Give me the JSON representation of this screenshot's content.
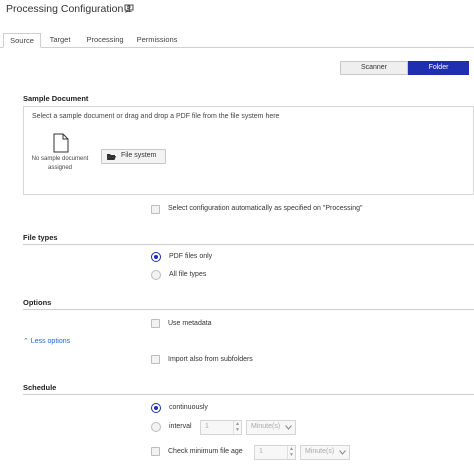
{
  "window": {
    "title": "Processing Configuration 1",
    "comment_icon": "comment-icon"
  },
  "tabs": [
    {
      "label": "Source",
      "active": true
    },
    {
      "label": "Target",
      "active": false
    },
    {
      "label": "Processing",
      "active": false
    },
    {
      "label": "Permissions",
      "active": false
    }
  ],
  "mode": {
    "scanner_label": "Scanner",
    "folder_label": "Folder",
    "selected": "Folder",
    "accent_color": "#1f2fb0"
  },
  "sample_document": {
    "header": "Sample Document",
    "hint": "Select a sample document or drag and drop a PDF file from the file system here",
    "no_sample_line1": "No sample document",
    "no_sample_line2": "assigned",
    "file_system_label": "File system",
    "auto_select_label": "Select configuration automatically as specified on \"Processing\"",
    "auto_select_checked": false
  },
  "file_types": {
    "header": "File types",
    "options": [
      {
        "label": "PDF files only",
        "selected": true
      },
      {
        "label": "All file types",
        "selected": false
      }
    ]
  },
  "options": {
    "header": "Options",
    "use_metadata_label": "Use metadata",
    "use_metadata_checked": false,
    "less_options_label": "⌃ Less options",
    "subfolders_label": "Import also from subfolders",
    "subfolders_checked": false
  },
  "schedule": {
    "header": "Schedule",
    "continuously_label": "continuously",
    "continuously_selected": true,
    "interval_label": "interval",
    "interval_selected": false,
    "interval_value": "1",
    "interval_unit": "Minute(s)",
    "min_age_label": "Check minimum file age",
    "min_age_checked": false,
    "min_age_value": "1",
    "min_age_unit": "Minute(s)"
  }
}
